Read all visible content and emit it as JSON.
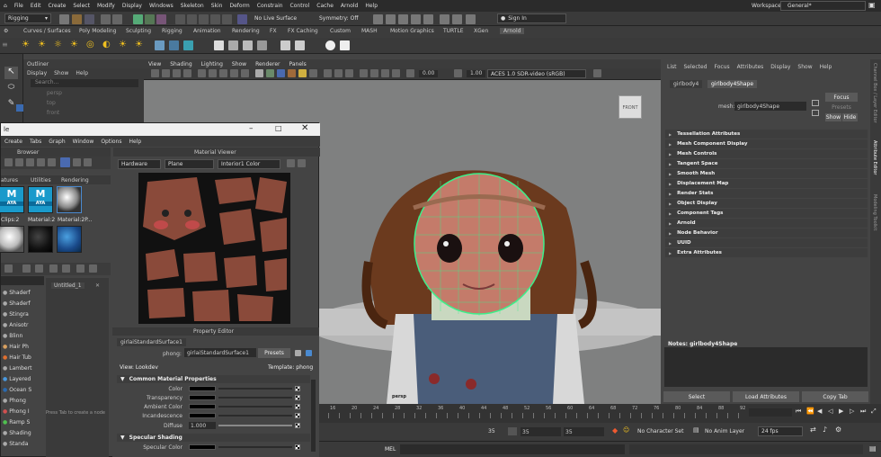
{
  "menubar": {
    "items": [
      "File",
      "Edit",
      "Create",
      "Select",
      "Modify",
      "Display",
      "Windows",
      "Skeleton",
      "Skin",
      "Deform",
      "Constrain",
      "Control",
      "Cache",
      "Arnold",
      "Help"
    ],
    "workspace_label": "Workspace:",
    "workspace_value": "General*"
  },
  "statusline": {
    "menuset": "Rigging",
    "live_surface": "No Live Surface",
    "symmetry": "Symmetry: Off",
    "sign_in": "Sign In"
  },
  "shelf_tabs": [
    "Curves / Surfaces",
    "Poly Modeling",
    "Sculpting",
    "Rigging",
    "Animation",
    "Rendering",
    "FX",
    "FX Caching",
    "Custom",
    "MASH",
    "Motion Graphics",
    "TURTLE",
    "XGen",
    "Arnold"
  ],
  "outliner": {
    "title": "Outliner",
    "menu": [
      "Display",
      "Show",
      "Help"
    ],
    "search": "Search...",
    "items": [
      "persp",
      "top",
      "front"
    ]
  },
  "viewport": {
    "menu": [
      "View",
      "Shading",
      "Lighting",
      "Show",
      "Renderer",
      "Panels"
    ],
    "field1": "0.00",
    "field2": "1.00",
    "colorspace": "ACES 1.0 SDR-video (sRGB)",
    "camera": "persp",
    "viewcube": "FRONT"
  },
  "attr_editor": {
    "menu": [
      "List",
      "Selected",
      "Focus",
      "Attributes",
      "Display",
      "Show",
      "Help"
    ],
    "tabs": [
      "girlbody4",
      "girlbody4Shape"
    ],
    "mesh_label": "mesh:",
    "mesh_value": "girlbody4Shape",
    "focus": "Focus",
    "presets": "Presets",
    "show": "Show",
    "hide": "Hide",
    "sections": [
      "Tessellation Attributes",
      "Mesh Component Display",
      "Mesh Controls",
      "Tangent Space",
      "Smooth Mesh",
      "Displacement Map",
      "Render Stats",
      "Object Display",
      "Component Tags",
      "Arnold",
      "Node Behavior",
      "UUID",
      "Extra Attributes"
    ],
    "notes": "Notes:  girlbody4Shape",
    "buttons": [
      "Select",
      "Load Attributes",
      "Copy Tab"
    ],
    "side_tabs": [
      "Channel Box / Layer Editor",
      "Attribute Editor",
      "Modeling Toolkit"
    ]
  },
  "hypershade": {
    "title_suffix": "le",
    "menu": [
      "Create",
      "Tabs",
      "Graph",
      "Window",
      "Options",
      "Help"
    ],
    "browser_label": "Browser",
    "browser_tabs": [
      "atures",
      "Utilities",
      "Rendering"
    ],
    "swatches": [
      {
        "label": "Clips:2",
        "type": "aya"
      },
      {
        "label": "Material:2",
        "type": "aya"
      },
      {
        "label": "Material:2P...",
        "type": "sphere"
      }
    ],
    "nodes": [
      "Shaderf",
      "Shaderf",
      "Stingra",
      "Anisotr",
      "Blinn",
      "Hair Ph",
      "Hair Tub",
      "Lambert",
      "Layered",
      "Ocean S",
      "Phong",
      "Phong I",
      "Ramp S",
      "Shading",
      "Standa"
    ],
    "graph_tab": "Untitled_1",
    "graph_hint": "Press Tab to create a node",
    "mat_viewer": {
      "title": "Material Viewer",
      "renderer": "Hardware",
      "geometry": "Plane",
      "env": "Interior1 Color"
    }
  },
  "property_editor": {
    "title": "Property Editor",
    "node": "girlaiStandardSurface1",
    "type_label": "phong:",
    "type_value": "girlaiStandardSurface1",
    "presets": "Presets",
    "view": "View: Lookdev",
    "template": "Template: phong",
    "section1": "Common Material Properties",
    "attrs": [
      "Color",
      "Transparency",
      "Ambient Color",
      "Incandescence",
      "Diffuse"
    ],
    "diffuse_value": "1.000",
    "section2": "Specular Shading",
    "attrs2": [
      "Specular Color"
    ]
  },
  "timeline": {
    "ticks": [
      "16",
      "18",
      "20",
      "22",
      "24",
      "26",
      "28",
      "30",
      "32",
      "34",
      "36",
      "38",
      "40",
      "42",
      "44",
      "46",
      "48",
      "50",
      "52",
      "54",
      "56",
      "58",
      "60",
      "62",
      "64",
      "66",
      "68",
      "70",
      "72",
      "74",
      "76",
      "78",
      "80",
      "82",
      "84",
      "86",
      "88",
      "90",
      "92"
    ]
  },
  "range": {
    "start": "35",
    "cur1": "35",
    "cur2": "35",
    "character": "No Character Set",
    "anim_layer": "No Anim Layer",
    "fps": "24 fps"
  },
  "cmdline": {
    "label": "MEL"
  }
}
